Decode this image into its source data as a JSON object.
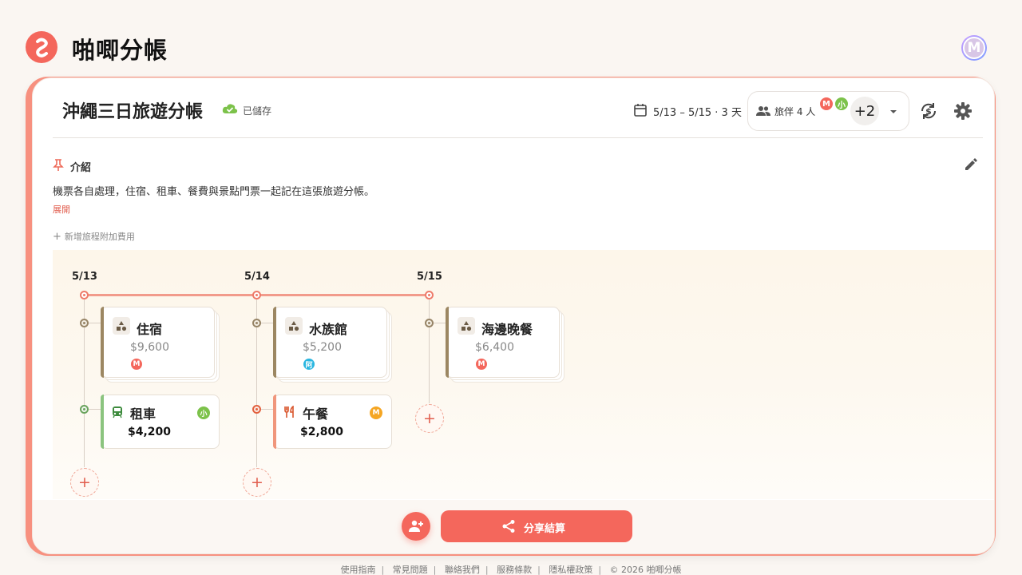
{
  "app": {
    "title": "啪唧分帳",
    "user_initial": "M"
  },
  "trip": {
    "title": "沖繩三日旅遊分帳",
    "saved": "已儲存",
    "date_range": "5/13 – 5/15 · 3 天",
    "companions_label": "旅伴 4 人",
    "companion_avatars": [
      {
        "initial": "M",
        "color": "#f4675c"
      },
      {
        "initial": "小",
        "color": "#7cc24a"
      }
    ],
    "extra_count": "+2"
  },
  "intro": {
    "label": "介紹",
    "text": "機票各自處理，住宿、租車、餐費與景點門票一起記在這張旅遊分帳。",
    "expand": "展開"
  },
  "add_extra": "新增旅程附加費用",
  "days": [
    {
      "date": "5/13",
      "group": {
        "name": "住宿",
        "amount": "$9,600",
        "payer": {
          "initial": "M",
          "color": "#f4675c"
        }
      },
      "expense": {
        "name": "租車",
        "amount": "$4,200",
        "payer": {
          "initial": "小",
          "color": "#7cc24a"
        },
        "accent": "#8bc47f",
        "icon": "car-icon"
      }
    },
    {
      "date": "5/14",
      "group": {
        "name": "水族館",
        "amount": "$5,200",
        "payer": {
          "initial": "阿",
          "color": "#29b6e0"
        }
      },
      "expense": {
        "name": "午餐",
        "amount": "$2,800",
        "payer": {
          "initial": "M",
          "color": "#f5a623"
        },
        "accent": "#f0967c",
        "icon": "utensils-icon"
      }
    },
    {
      "date": "5/15",
      "group": {
        "name": "海邊晚餐",
        "amount": "$6,400",
        "payer": {
          "initial": "M",
          "color": "#f4675c"
        }
      }
    }
  ],
  "actions": {
    "share_label": "分享結算"
  },
  "footer": {
    "links": [
      "使用指南",
      "常見問題",
      "聯絡我們",
      "服務條款",
      "隱私權政策"
    ],
    "copyright": "© 2026 啪唧分帳"
  },
  "colors": {
    "brand": "#f4675c",
    "accent_timeline": "#f29b8b"
  }
}
